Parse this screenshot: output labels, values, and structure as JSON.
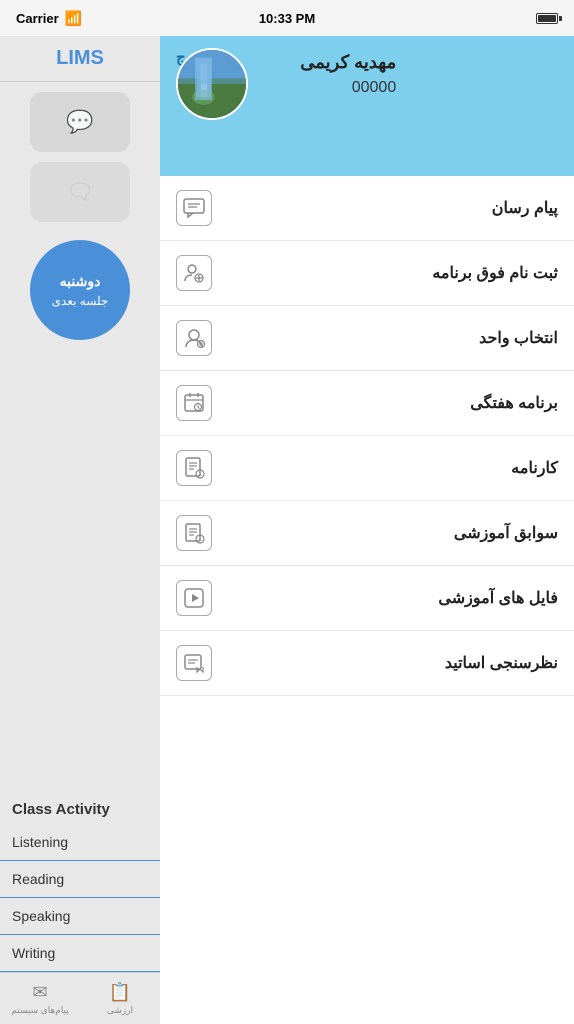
{
  "statusBar": {
    "carrier": "Carrier",
    "time": "10:33 PM",
    "signal": "wifi"
  },
  "sidebar": {
    "logo": "LIMS",
    "circle": {
      "day": "دوشنبه",
      "label": "جلسه بعدی"
    },
    "activityTitle": "Class Activity",
    "activityItems": [
      {
        "label": "Listening"
      },
      {
        "label": "Reading"
      },
      {
        "label": "Speaking"
      },
      {
        "label": "Writing"
      }
    ],
    "footerItems": [
      {
        "label": "پیام‌های سیستم",
        "icon": "✉"
      },
      {
        "label": "ارزشی",
        "icon": "📋"
      }
    ]
  },
  "profile": {
    "logoutLabel": "خروج",
    "name": "مهدیه کریمی",
    "id": "00000"
  },
  "menuItems": [
    {
      "label": "پیام رسان",
      "iconType": "chat"
    },
    {
      "label": "ثبت نام فوق برنامه",
      "iconType": "group-add"
    },
    {
      "label": "انتخاب واحد",
      "iconType": "person-add"
    },
    {
      "label": "برنامه هفتگی",
      "iconType": "calendar-clock"
    },
    {
      "label": "کارنامه",
      "iconType": "report"
    },
    {
      "label": "سوابق آموزشی",
      "iconType": "history"
    },
    {
      "label": "فایل های آموزشی",
      "iconType": "play"
    },
    {
      "label": "نظرسنجی اساتید",
      "iconType": "survey"
    }
  ]
}
